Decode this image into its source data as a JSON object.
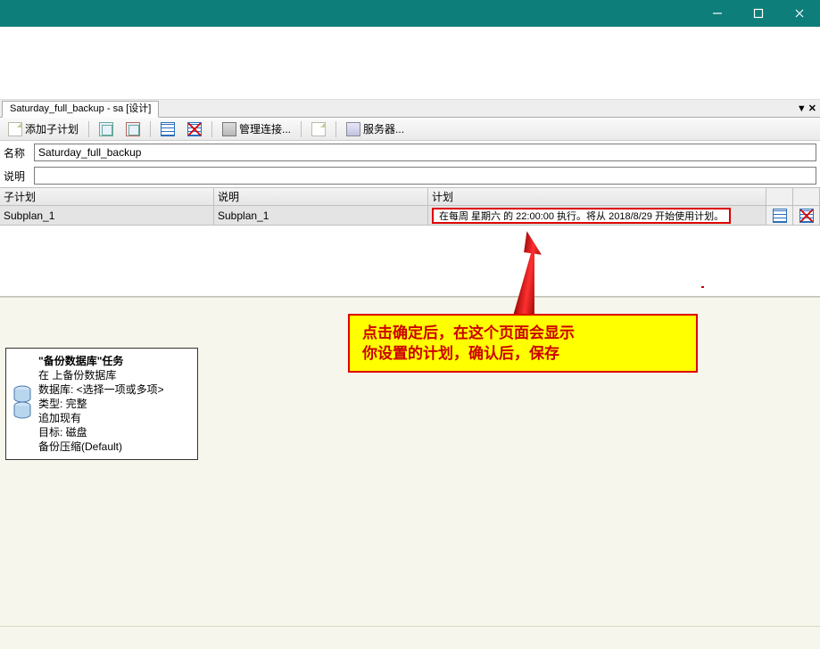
{
  "titlebar": {},
  "subtab": {
    "title": "Saturday_full_backup - sa [设计]"
  },
  "toolbar": {
    "add_subplan": "添加子计划",
    "manage_conn": "管理连接...",
    "servers": "服务器..."
  },
  "form": {
    "name_label": "名称",
    "name_value": "Saturday_full_backup",
    "desc_label": "说明",
    "desc_value": ""
  },
  "grid": {
    "headers": {
      "subplan": "子计划",
      "desc": "说明",
      "schedule": "计划"
    },
    "rows": [
      {
        "name": "Subplan_1",
        "desc": "Subplan_1",
        "schedule": "在每周 星期六 的 22:00:00 执行。将从 2018/8/29 开始使用计划。"
      }
    ]
  },
  "task": {
    "title": "\"备份数据库\"任务",
    "l1": "在 上备份数据库",
    "l2": "数据库: <选择一项或多项>",
    "l3": "类型: 完整",
    "l4": "追加现有",
    "l5": "目标: 磁盘",
    "l6": "备份压缩(Default)"
  },
  "annotation": {
    "line1": "点击确定后，在这个页面会显示",
    "line2": "你设置的计划，确认后，保存"
  }
}
